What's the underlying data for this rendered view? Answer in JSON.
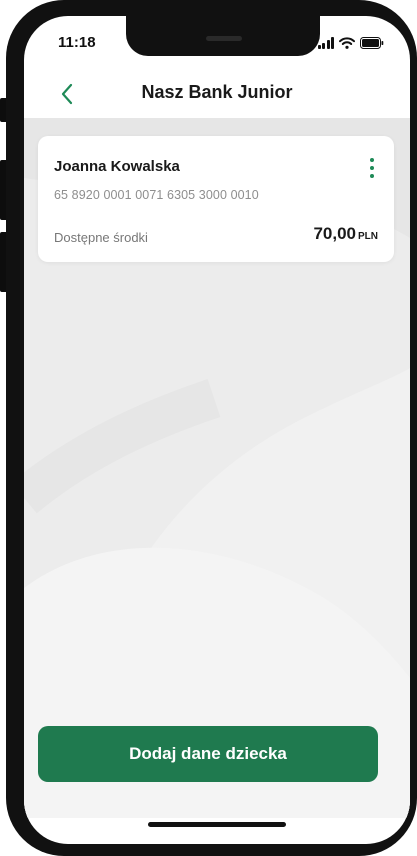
{
  "status_bar": {
    "time": "11:18",
    "signal_icon": "cellular-signal-icon",
    "wifi_icon": "wifi-icon",
    "battery_icon": "battery-icon"
  },
  "header": {
    "title": "Nasz Bank Junior",
    "back_icon": "chevron-left-icon"
  },
  "account_card": {
    "holder_name": "Joanna Kowalska",
    "account_number": "65 8920 0001 0071 6305 3000 0010",
    "available_label": "Dostępne środki",
    "available_amount": "70,00",
    "currency": "PLN",
    "menu_icon": "more-vertical-icon"
  },
  "actions": {
    "add_child_label": "Dodaj dane dziecka"
  },
  "colors": {
    "brand_green": "#1f7a4f",
    "accent_green": "#1e8a57",
    "content_background": "#ececec"
  }
}
